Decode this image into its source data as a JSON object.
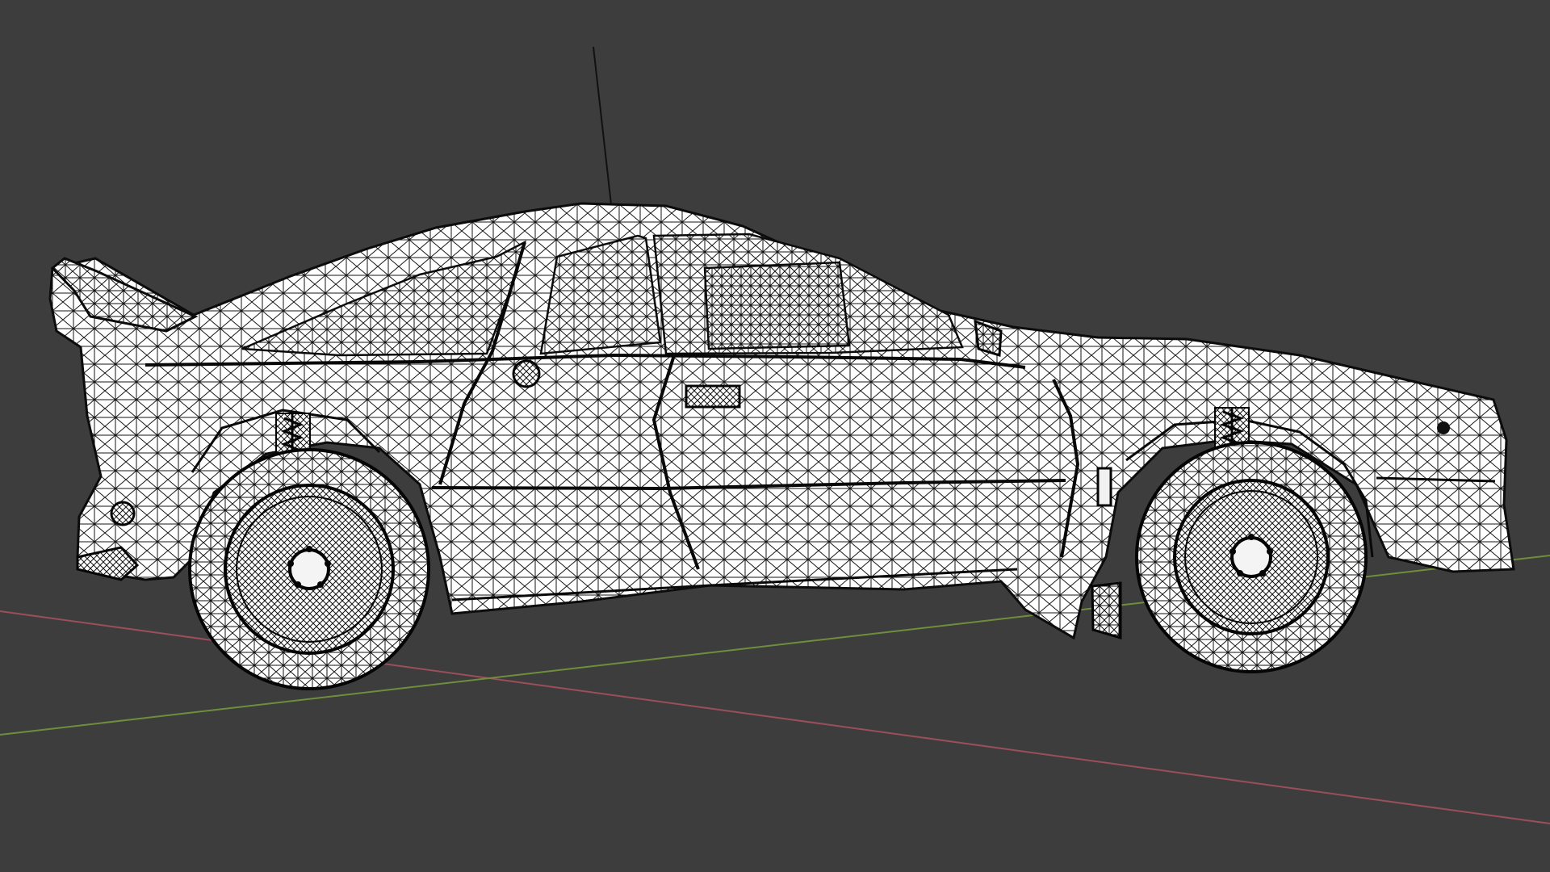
{
  "viewport": {
    "background_color": "#3d3d3d",
    "mode": "wireframe"
  },
  "scene": {
    "object": "rally-car",
    "view": "side",
    "wire_color": "#ffffff",
    "edge_color": "#111111",
    "axes": {
      "x_axis_color": "#9a4f5a",
      "y_axis_color": "#6f8e3d"
    }
  }
}
